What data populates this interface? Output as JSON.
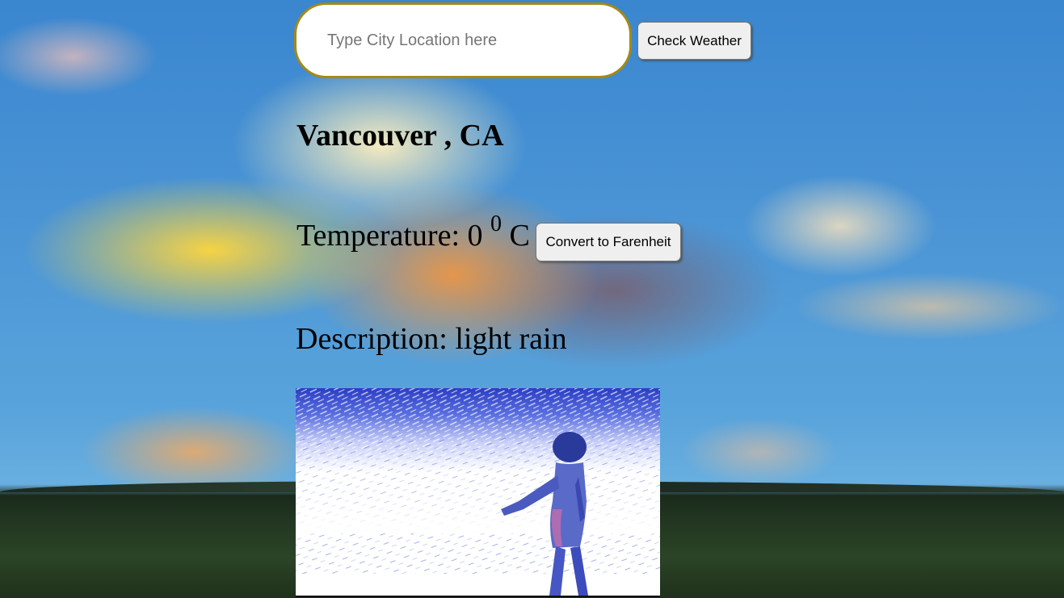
{
  "search": {
    "placeholder": "Type City Location here",
    "value": "",
    "button_label": "Check Weather"
  },
  "result": {
    "city_label": "Vancouver , CA",
    "temperature_prefix": "Temperature: 0 ",
    "temperature_degree_mark": "0",
    "temperature_unit": " C",
    "convert_button_label": "Convert to Farenheit",
    "description_label": "Description: light rain"
  },
  "image": {
    "subject": "rain-figure-illustration"
  },
  "colors": {
    "input_border": "#a38a14",
    "button_bg": "#efefef",
    "text": "#000000"
  }
}
